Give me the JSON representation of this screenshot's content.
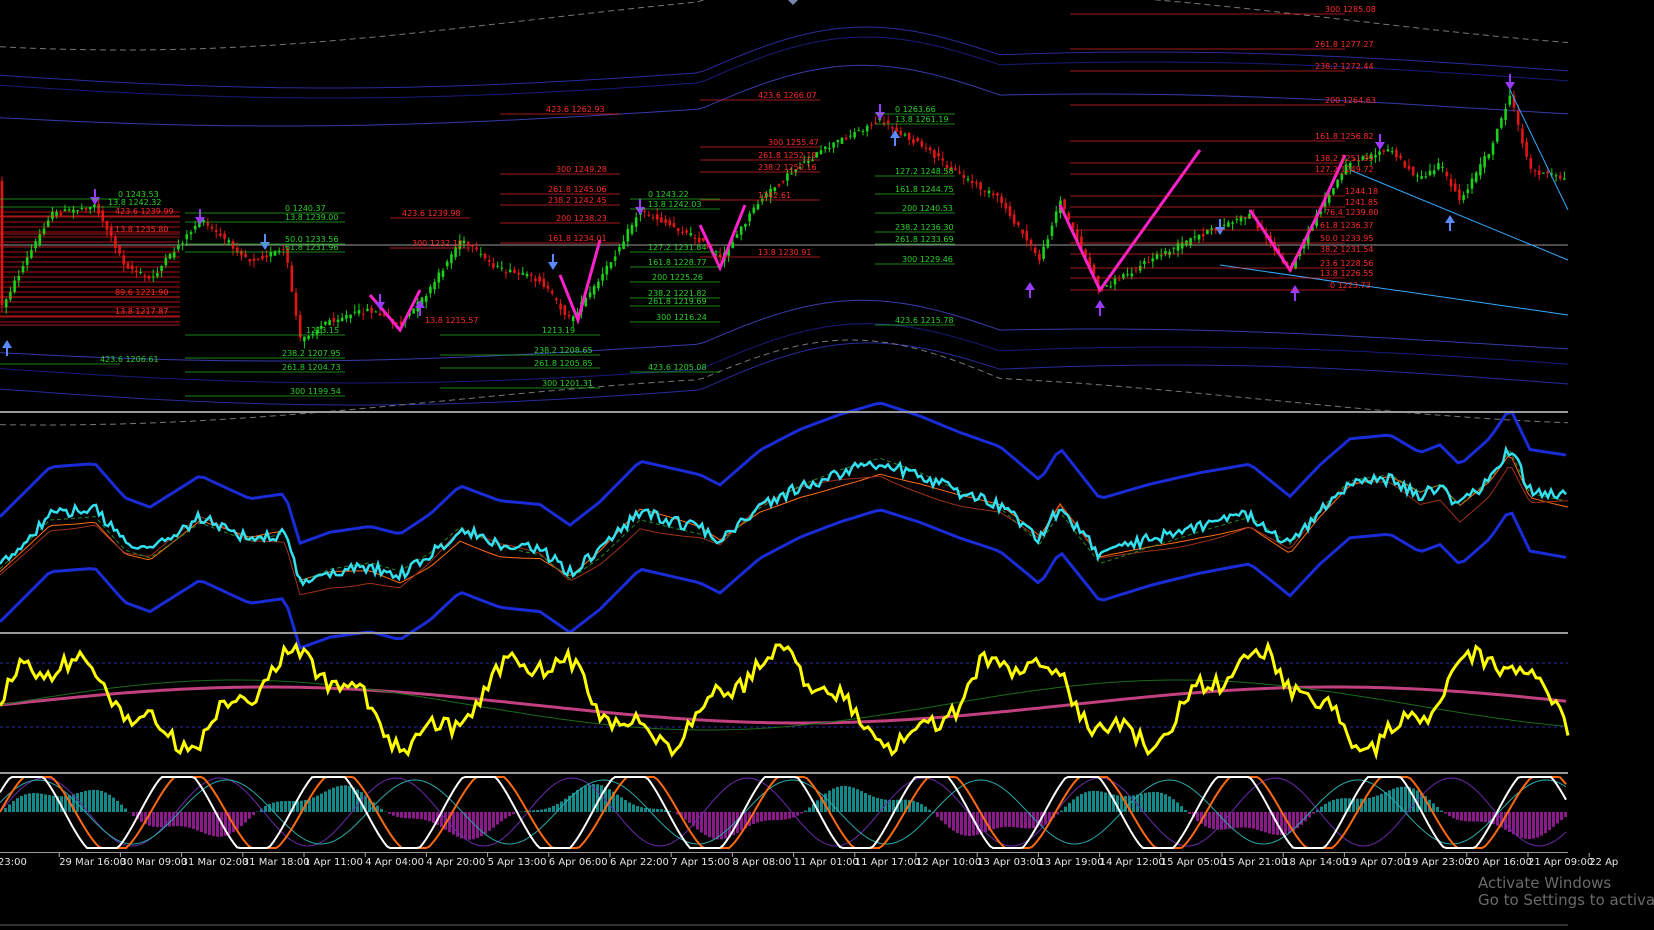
{
  "time_axis": [
    "23:00",
    "29 Mar 16:00",
    "30 Mar 09:00",
    "31 Mar 02:00",
    "31 Mar 18:00",
    "1 Apr 11:00",
    "4 Apr 04:00",
    "4 Apr 20:00",
    "5 Apr 13:00",
    "6 Apr 06:00",
    "6 Apr 22:00",
    "7 Apr 15:00",
    "8 Apr 08:00",
    "11 Apr 01:00",
    "11 Apr 17:00",
    "12 Apr 10:00",
    "13 Apr 03:00",
    "13 Apr 19:00",
    "14 Apr 12:00",
    "15 Apr 05:00",
    "15 Apr 21:00",
    "18 Apr 14:00",
    "19 Apr 07:00",
    "19 Apr 23:00",
    "20 Apr 16:00",
    "21 Apr 09:00",
    "22 Ap"
  ],
  "fib_labels": [
    {
      "text": "300 1285.08",
      "color": "red"
    },
    {
      "text": "261.8 1277.27",
      "color": "red"
    },
    {
      "text": "238.2 1272.44",
      "color": "red"
    },
    {
      "text": "200 1264.63",
      "color": "red"
    },
    {
      "text": "161.8 1256.82",
      "color": "red"
    },
    {
      "text": "138.2 1251.99",
      "color": "red"
    },
    {
      "text": "127.2 1249.72",
      "color": "red"
    },
    {
      "text": "1244.18",
      "color": "red"
    },
    {
      "text": "1241.85",
      "color": "red"
    },
    {
      "text": "76.4 1239.80",
      "color": "red"
    },
    {
      "text": "61.8 1236.37",
      "color": "red"
    },
    {
      "text": "50.0 1233.95",
      "color": "red"
    },
    {
      "text": "38.2 1231.54",
      "color": "red"
    },
    {
      "text": "23.6 1228.56",
      "color": "red"
    },
    {
      "text": "13.8 1226.55",
      "color": "red"
    },
    {
      "text": "0 1223.73",
      "color": "red"
    },
    {
      "text": "423.6 1266.07",
      "color": "red"
    },
    {
      "text": "300 1255.47",
      "color": "red"
    },
    {
      "text": "261.8 1252.19",
      "color": "red"
    },
    {
      "text": "238.2 1250.16",
      "color": "red"
    },
    {
      "text": "1242.61",
      "color": "red"
    },
    {
      "text": "13.8 1230.91",
      "color": "red"
    },
    {
      "text": "423.6 1262.93",
      "color": "red"
    },
    {
      "text": "300 1249.28",
      "color": "red"
    },
    {
      "text": "261.8 1245.06",
      "color": "red"
    },
    {
      "text": "238.2 1242.45",
      "color": "red"
    },
    {
      "text": "200 1238.23",
      "color": "red"
    },
    {
      "text": "161.8 1234.01",
      "color": "red"
    },
    {
      "text": "423.6 1239.98",
      "color": "red"
    },
    {
      "text": "300 1232.10",
      "color": "red"
    },
    {
      "text": "423.6 1239.99",
      "color": "red"
    },
    {
      "text": "13.8 1235.80",
      "color": "red"
    },
    {
      "text": "89.6 1221.90",
      "color": "red"
    },
    {
      "text": "13.8 1217.87",
      "color": "red"
    },
    {
      "text": "13.8 1215.57",
      "color": "red"
    },
    {
      "text": "0 1263.66",
      "color": "green"
    },
    {
      "text": "13.8 1261.19",
      "color": "green"
    },
    {
      "text": "127.2 1248.58",
      "color": "green"
    },
    {
      "text": "161.8 1244.75",
      "color": "green"
    },
    {
      "text": "200 1240.53",
      "color": "green"
    },
    {
      "text": "238.2 1236.30",
      "color": "green"
    },
    {
      "text": "261.8 1233.69",
      "color": "green"
    },
    {
      "text": "300 1229.46",
      "color": "green"
    },
    {
      "text": "423.6 1215.78",
      "color": "green"
    },
    {
      "text": "0 1243.22",
      "color": "green"
    },
    {
      "text": "13.8 1242.03",
      "color": "green"
    },
    {
      "text": "127.2 1231.84",
      "color": "green"
    },
    {
      "text": "161.8 1228.77",
      "color": "green"
    },
    {
      "text": "200 1225.26",
      "color": "green"
    },
    {
      "text": "238.2 1221.82",
      "color": "green"
    },
    {
      "text": "261.8 1219.69",
      "color": "green"
    },
    {
      "text": "300 1216.24",
      "color": "green"
    },
    {
      "text": "423.6 1205.08",
      "color": "green"
    },
    {
      "text": "0 1240.37",
      "color": "green"
    },
    {
      "text": "13.8 1239.00",
      "color": "green"
    },
    {
      "text": "50.0 1233.56",
      "color": "green"
    },
    {
      "text": "61.8 1231.96",
      "color": "green"
    },
    {
      "text": "1213.15",
      "color": "green"
    },
    {
      "text": "238.2 1207.95",
      "color": "green"
    },
    {
      "text": "261.8 1204.73",
      "color": "green"
    },
    {
      "text": "300 1199.54",
      "color": "green"
    },
    {
      "text": "0 1243.53",
      "color": "green"
    },
    {
      "text": "13.8 1242.32",
      "color": "green"
    },
    {
      "text": "423.6 1206.61",
      "color": "green"
    },
    {
      "text": "1213.19",
      "color": "green"
    },
    {
      "text": "238.2 1208.65",
      "color": "green"
    },
    {
      "text": "261.8 1205.85",
      "color": "green"
    },
    {
      "text": "300 1201.31",
      "color": "green"
    }
  ],
  "watermark": {
    "line1": "Activate Windows",
    "line2": "Go to Settings to activate Windows."
  },
  "colors": {
    "background": "#000000",
    "bull_candle": "#19d219",
    "bear_candle": "#e01616",
    "fib_red": "#ff2a2a",
    "fib_green": "#2ad02a",
    "zigzag": "#ff22cc",
    "signal_line": "#33e0f0",
    "band_blue": "#1a2bd8",
    "oscillator": "#ffff00",
    "stoch_main": "#ffffff",
    "stoch_signal": "#ff6a10",
    "hist_up": "#138a8a",
    "hist_down": "#8a1a8a",
    "separator": "#9a9a9a"
  }
}
